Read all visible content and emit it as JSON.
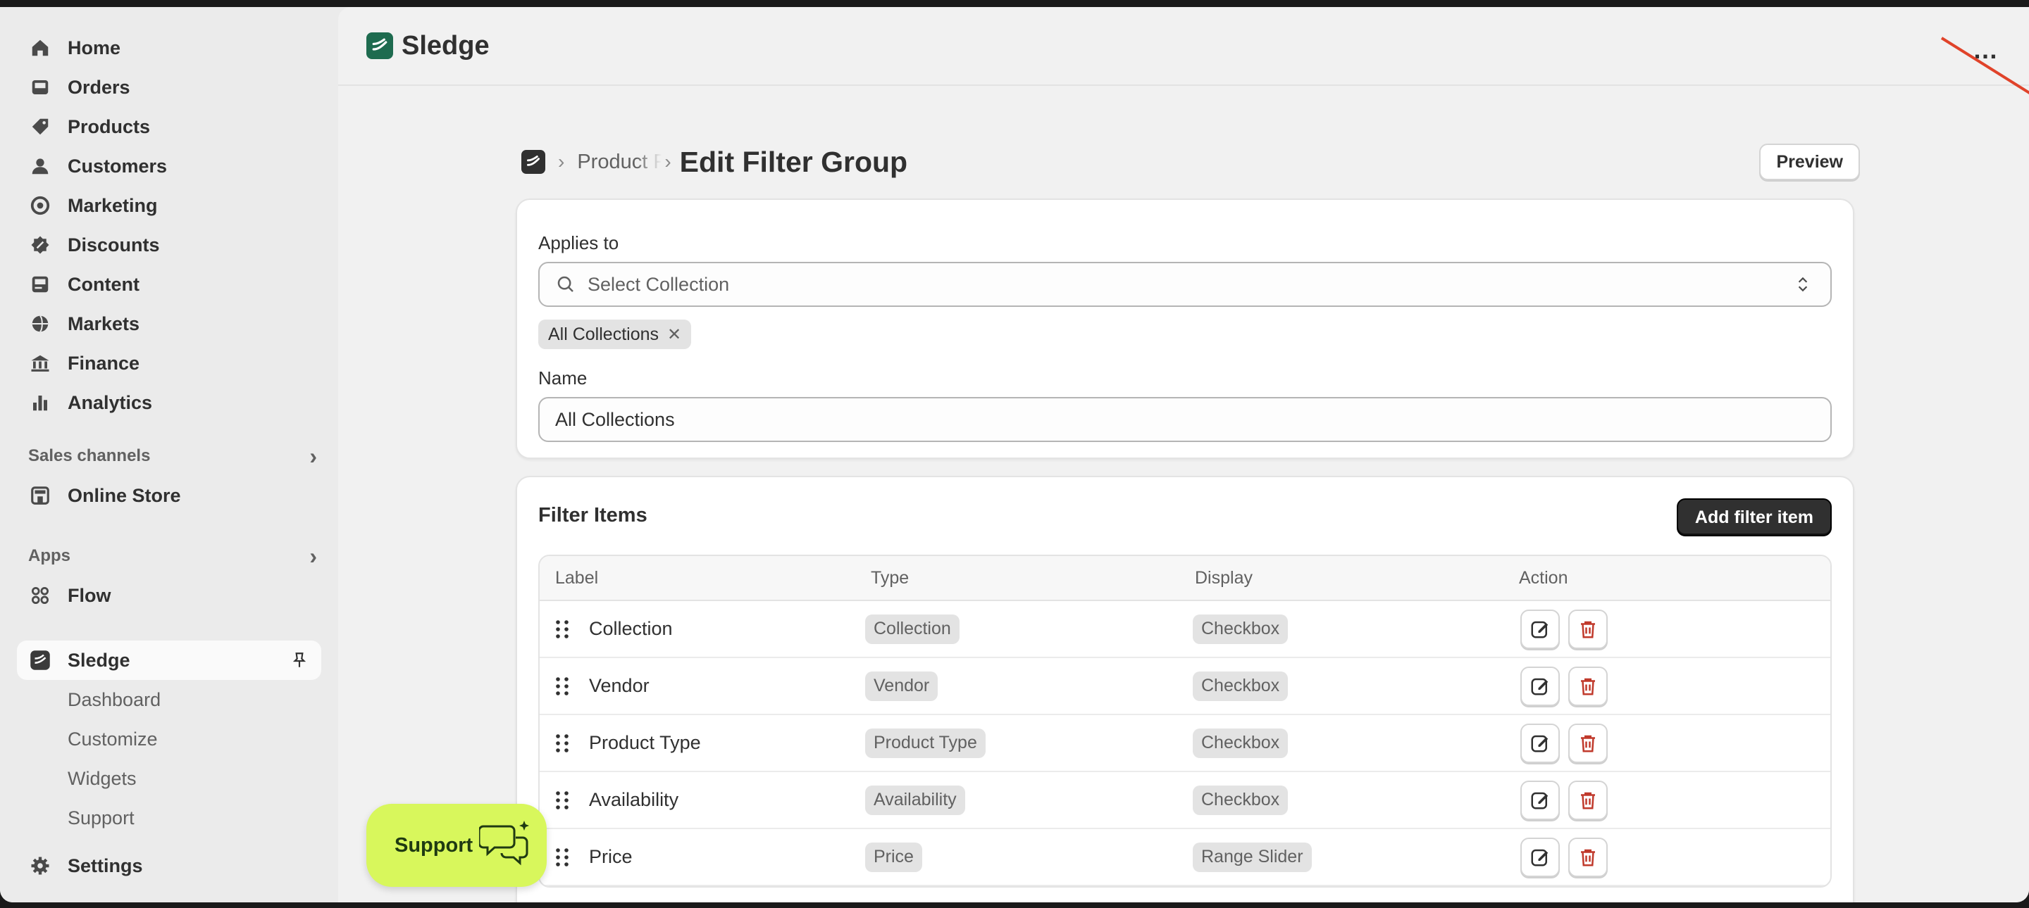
{
  "sidebar": {
    "nav": [
      {
        "label": "Home",
        "icon": "home-icon"
      },
      {
        "label": "Orders",
        "icon": "inbox-icon"
      },
      {
        "label": "Products",
        "icon": "tag-icon"
      },
      {
        "label": "Customers",
        "icon": "person-icon"
      },
      {
        "label": "Marketing",
        "icon": "target-icon"
      },
      {
        "label": "Discounts",
        "icon": "discount-icon"
      },
      {
        "label": "Content",
        "icon": "content-icon"
      },
      {
        "label": "Markets",
        "icon": "globe-icon"
      },
      {
        "label": "Finance",
        "icon": "bank-icon"
      },
      {
        "label": "Analytics",
        "icon": "bar-chart-icon"
      }
    ],
    "sales_channels_label": "Sales channels",
    "online_store_label": "Online Store",
    "apps_label": "Apps",
    "flow_label": "Flow",
    "sledge_label": "Sledge",
    "sledge_sub": [
      "Dashboard",
      "Customize",
      "Widgets",
      "Support"
    ],
    "settings_label": "Settings"
  },
  "topbar": {
    "app_name": "Sledge",
    "more_label": "…"
  },
  "header": {
    "breadcrumb": "Product F",
    "title": "Edit Filter Group",
    "preview_label": "Preview"
  },
  "applies_card": {
    "applies_label": "Applies to",
    "select_placeholder": "Select Collection",
    "tag_label": "All Collections",
    "name_label": "Name",
    "name_value": "All Collections"
  },
  "filter_card": {
    "title": "Filter Items",
    "add_label": "Add filter item",
    "columns": {
      "label": "Label",
      "type": "Type",
      "display": "Display",
      "action": "Action"
    },
    "rows": [
      {
        "label": "Collection",
        "type": "Collection",
        "display": "Checkbox"
      },
      {
        "label": "Vendor",
        "type": "Vendor",
        "display": "Checkbox"
      },
      {
        "label": "Product Type",
        "type": "Product Type",
        "display": "Checkbox"
      },
      {
        "label": "Availability",
        "type": "Availability",
        "display": "Checkbox"
      },
      {
        "label": "Price",
        "type": "Price",
        "display": "Range Slider"
      }
    ]
  },
  "support_button": {
    "label": "Support"
  },
  "colors": {
    "accent": "#303030",
    "brand_green": "#1e6b4f",
    "support_bg": "#d8f75c",
    "annotation_arrow": "#e0432a",
    "delete_red": "#c0392b"
  }
}
